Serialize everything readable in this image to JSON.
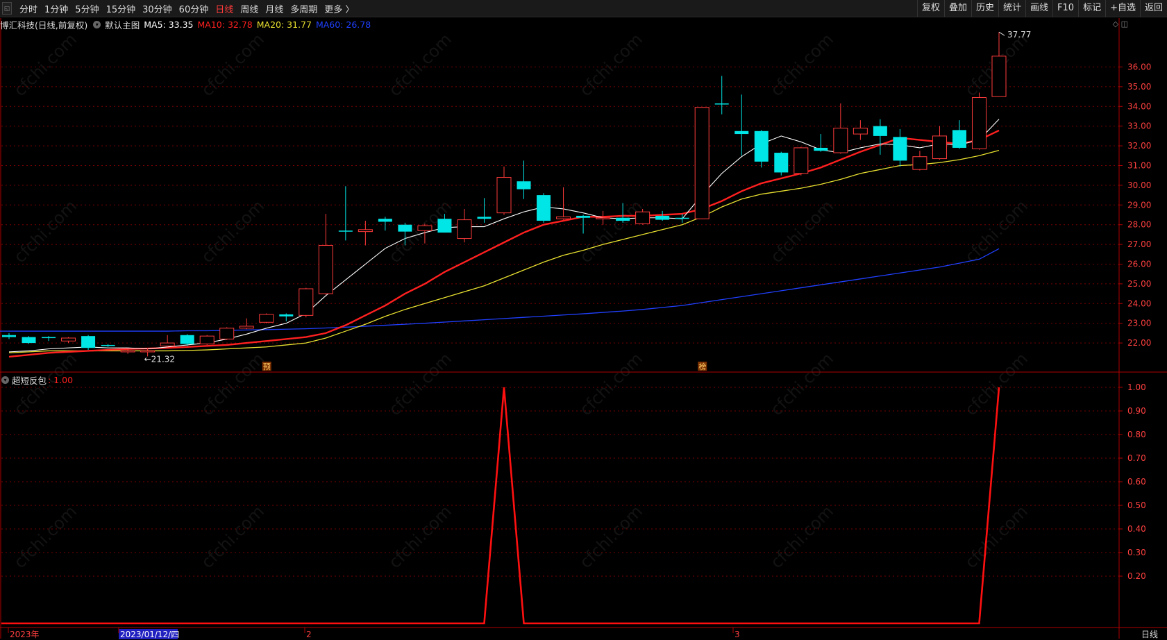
{
  "toolbar": {
    "periods": [
      "分时",
      "1分钟",
      "5分钟",
      "15分钟",
      "30分钟",
      "60分钟",
      "日线",
      "周线",
      "月线",
      "多周期",
      "更多 〉"
    ],
    "active_period": "日线",
    "right_buttons": [
      "复权",
      "叠加",
      "历史",
      "统计",
      "画线",
      "F10",
      "标记",
      "+自选",
      "返回"
    ]
  },
  "main_chart": {
    "stock": "博汇科技(日线,前复权)",
    "template": "默认主图",
    "ma": [
      {
        "label": "MA5: 33.35",
        "color": "#ffffff"
      },
      {
        "label": "MA10: 32.78",
        "color": "#ff2020"
      },
      {
        "label": "MA20: 31.77",
        "color": "#e8e030"
      },
      {
        "label": "MA60: 26.78",
        "color": "#2040ff"
      }
    ],
    "high_label": "37.77",
    "low_label": "←21.32",
    "markers": [
      "预",
      "榜"
    ],
    "y_ticks": [
      "36.00",
      "35.00",
      "34.00",
      "33.00",
      "32.00",
      "31.00",
      "30.00",
      "29.00",
      "28.00",
      "27.00",
      "26.00",
      "25.00",
      "24.00",
      "23.00",
      "22.00"
    ]
  },
  "indicator": {
    "name": "超短反包",
    "value": ": 1.00",
    "y_ticks": [
      "1.00",
      "0.90",
      "0.80",
      "0.70",
      "0.60",
      "0.50",
      "0.40",
      "0.30",
      "0.20"
    ]
  },
  "x_axis": {
    "labels": [
      "2023年",
      "2023/01/12/四",
      "2",
      "3"
    ],
    "right_label": "日线"
  },
  "watermark": "cfchi.com",
  "colors": {
    "up": "#ff3b3b",
    "down": "#00e5e5",
    "ma5": "#ffffff",
    "ma10": "#ff2020",
    "ma20": "#e8e030",
    "ma60": "#2040ff",
    "grid": "#7a0000"
  },
  "chart_data": {
    "type": "candlestick",
    "candles": [
      {
        "o": 22.4,
        "c": 22.3,
        "h": 22.5,
        "l": 22.2
      },
      {
        "o": 22.3,
        "c": 22.0,
        "h": 22.35,
        "l": 21.95
      },
      {
        "o": 22.3,
        "c": 22.25,
        "h": 22.35,
        "l": 22.1
      },
      {
        "o": 22.1,
        "c": 22.25,
        "h": 22.3,
        "l": 22.0
      },
      {
        "o": 22.35,
        "c": 21.75,
        "h": 22.4,
        "l": 21.65
      },
      {
        "o": 21.9,
        "c": 21.85,
        "h": 21.95,
        "l": 21.8
      },
      {
        "o": 21.55,
        "c": 21.6,
        "h": 21.7,
        "l": 21.45
      },
      {
        "o": 21.55,
        "c": 21.6,
        "h": 21.75,
        "l": 21.32
      },
      {
        "o": 21.85,
        "c": 22.0,
        "h": 22.4,
        "l": 21.8
      },
      {
        "o": 22.4,
        "c": 21.95,
        "h": 22.45,
        "l": 21.85
      },
      {
        "o": 21.95,
        "c": 22.35,
        "h": 22.4,
        "l": 21.9
      },
      {
        "o": 22.2,
        "c": 22.75,
        "h": 22.8,
        "l": 22.15
      },
      {
        "o": 22.75,
        "c": 22.85,
        "h": 23.25,
        "l": 22.7
      },
      {
        "o": 23.05,
        "c": 23.45,
        "h": 23.5,
        "l": 23.0
      },
      {
        "o": 23.45,
        "c": 23.35,
        "h": 23.5,
        "l": 23.1
      },
      {
        "o": 23.4,
        "c": 24.75,
        "h": 24.8,
        "l": 23.3
      },
      {
        "o": 24.5,
        "c": 26.95,
        "h": 28.55,
        "l": 24.45
      },
      {
        "o": 27.7,
        "c": 27.65,
        "h": 29.95,
        "l": 27.2
      },
      {
        "o": 27.65,
        "c": 27.75,
        "h": 28.2,
        "l": 26.95
      },
      {
        "o": 28.3,
        "c": 28.15,
        "h": 28.4,
        "l": 27.7
      },
      {
        "o": 28.0,
        "c": 27.65,
        "h": 28.1,
        "l": 26.95
      },
      {
        "o": 27.7,
        "c": 27.95,
        "h": 28.05,
        "l": 27.05
      },
      {
        "o": 28.3,
        "c": 27.6,
        "h": 28.55,
        "l": 27.6
      },
      {
        "o": 27.3,
        "c": 28.25,
        "h": 28.8,
        "l": 27.1
      },
      {
        "o": 28.4,
        "c": 28.3,
        "h": 29.35,
        "l": 28.1
      },
      {
        "o": 28.6,
        "c": 30.4,
        "h": 30.95,
        "l": 28.5
      },
      {
        "o": 30.2,
        "c": 29.8,
        "h": 31.25,
        "l": 29.3
      },
      {
        "o": 29.5,
        "c": 28.2,
        "h": 29.6,
        "l": 28.1
      },
      {
        "o": 28.3,
        "c": 28.4,
        "h": 29.9,
        "l": 28.25
      },
      {
        "o": 28.45,
        "c": 28.35,
        "h": 28.5,
        "l": 27.55
      },
      {
        "o": 28.35,
        "c": 28.35,
        "h": 28.7,
        "l": 28.0
      },
      {
        "o": 28.35,
        "c": 28.2,
        "h": 29.1,
        "l": 28.1
      },
      {
        "o": 28.05,
        "c": 28.65,
        "h": 28.8,
        "l": 28.0
      },
      {
        "o": 28.45,
        "c": 28.25,
        "h": 28.7,
        "l": 28.2
      },
      {
        "o": 28.35,
        "c": 28.3,
        "h": 28.55,
        "l": 28.1
      },
      {
        "o": 28.3,
        "c": 33.95,
        "h": 33.95,
        "l": 28.3
      },
      {
        "o": 34.15,
        "c": 34.1,
        "h": 35.55,
        "l": 33.6
      },
      {
        "o": 32.75,
        "c": 32.6,
        "h": 34.6,
        "l": 31.5
      },
      {
        "o": 32.75,
        "c": 31.2,
        "h": 32.8,
        "l": 30.9
      },
      {
        "o": 31.65,
        "c": 30.65,
        "h": 31.7,
        "l": 30.5
      },
      {
        "o": 30.6,
        "c": 31.9,
        "h": 31.95,
        "l": 30.5
      },
      {
        "o": 31.9,
        "c": 31.75,
        "h": 32.6,
        "l": 31.7
      },
      {
        "o": 31.65,
        "c": 32.9,
        "h": 34.15,
        "l": 31.6
      },
      {
        "o": 32.6,
        "c": 32.9,
        "h": 33.3,
        "l": 32.3
      },
      {
        "o": 33.0,
        "c": 32.5,
        "h": 33.35,
        "l": 31.55
      },
      {
        "o": 32.45,
        "c": 31.25,
        "h": 32.85,
        "l": 30.95
      },
      {
        "o": 30.8,
        "c": 31.45,
        "h": 31.75,
        "l": 30.75
      },
      {
        "o": 31.35,
        "c": 32.5,
        "h": 33.0,
        "l": 31.3
      },
      {
        "o": 32.8,
        "c": 31.9,
        "h": 33.3,
        "l": 31.85
      },
      {
        "o": 31.85,
        "c": 34.45,
        "h": 34.7,
        "l": 31.8
      },
      {
        "o": 34.5,
        "c": 36.55,
        "h": 37.77,
        "l": 34.5
      }
    ],
    "ma5": [
      21.55,
      21.6,
      21.7,
      21.75,
      21.8,
      21.75,
      21.75,
      21.7,
      21.8,
      21.9,
      22.0,
      22.2,
      22.45,
      22.75,
      23.0,
      23.5,
      24.4,
      25.2,
      26.0,
      26.8,
      27.3,
      27.6,
      27.85,
      27.9,
      27.9,
      28.3,
      28.65,
      28.9,
      28.8,
      28.6,
      28.35,
      28.3,
      28.35,
      28.35,
      28.3,
      29.5,
      30.6,
      31.45,
      32.1,
      32.5,
      32.2,
      31.8,
      31.65,
      31.9,
      32.1,
      32.05,
      31.9,
      32.1,
      32.05,
      32.3,
      33.35
    ],
    "ma10": [
      21.3,
      21.4,
      21.5,
      21.55,
      21.6,
      21.65,
      21.7,
      21.72,
      21.75,
      21.8,
      21.85,
      21.9,
      22.0,
      22.1,
      22.2,
      22.3,
      22.5,
      22.9,
      23.4,
      23.9,
      24.5,
      25.0,
      25.6,
      26.1,
      26.6,
      27.1,
      27.6,
      28.0,
      28.2,
      28.4,
      28.4,
      28.45,
      28.45,
      28.5,
      28.55,
      28.8,
      29.2,
      29.7,
      30.1,
      30.35,
      30.6,
      30.9,
      31.3,
      31.7,
      32.05,
      32.4,
      32.3,
      32.2,
      32.1,
      32.3,
      32.78
    ],
    "ma20": [
      21.5,
      21.55,
      21.6,
      21.6,
      21.6,
      21.6,
      21.6,
      21.6,
      21.6,
      21.62,
      21.65,
      21.7,
      21.75,
      21.8,
      21.9,
      22.0,
      22.25,
      22.6,
      22.95,
      23.35,
      23.7,
      24.0,
      24.3,
      24.6,
      24.9,
      25.3,
      25.7,
      26.1,
      26.45,
      26.7,
      27.0,
      27.25,
      27.5,
      27.75,
      28.0,
      28.4,
      28.9,
      29.3,
      29.55,
      29.7,
      29.85,
      30.05,
      30.3,
      30.6,
      30.8,
      31.0,
      31.05,
      31.15,
      31.3,
      31.5,
      31.77
    ],
    "ma60": [
      22.6,
      22.6,
      22.6,
      22.6,
      22.6,
      22.6,
      22.6,
      22.6,
      22.6,
      22.62,
      22.62,
      22.64,
      22.66,
      22.68,
      22.7,
      22.72,
      22.76,
      22.8,
      22.85,
      22.9,
      22.95,
      23.0,
      23.06,
      23.12,
      23.18,
      23.24,
      23.3,
      23.36,
      23.42,
      23.48,
      23.55,
      23.62,
      23.7,
      23.8,
      23.9,
      24.05,
      24.2,
      24.35,
      24.5,
      24.65,
      24.8,
      24.95,
      25.1,
      25.25,
      25.4,
      25.55,
      25.7,
      25.85,
      26.05,
      26.25,
      26.78
    ],
    "indicator_values": [
      0,
      0,
      0,
      0,
      0,
      0,
      0,
      0,
      0,
      0,
      0,
      0,
      0,
      0,
      0,
      0,
      0,
      0,
      0,
      0,
      0,
      0,
      0,
      0,
      0,
      1,
      0,
      0,
      0,
      0,
      0,
      0,
      0,
      0,
      0,
      0,
      0,
      0,
      0,
      0,
      0,
      0,
      0,
      0,
      0,
      0,
      0,
      0,
      0,
      0,
      1
    ],
    "ylim": [
      21,
      37.77
    ],
    "indicator_ylim": [
      0,
      1
    ]
  }
}
